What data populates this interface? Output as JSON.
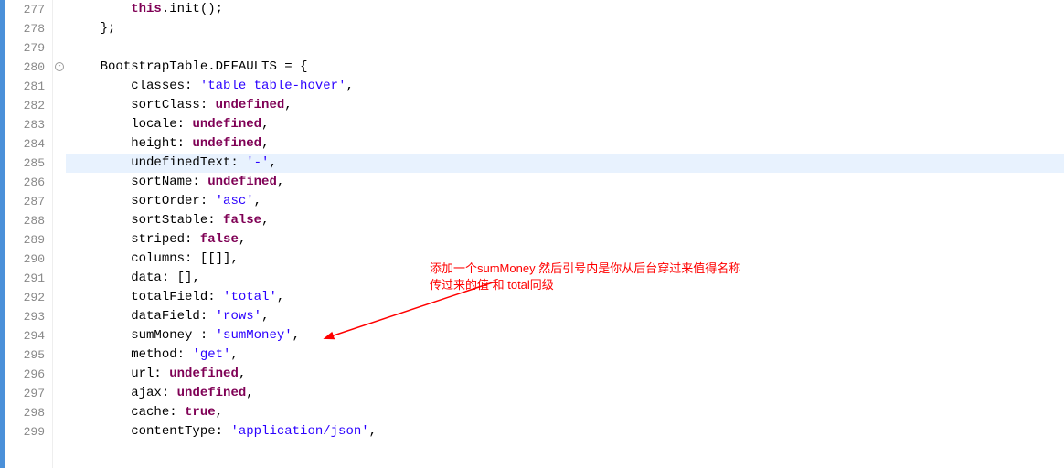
{
  "lineNumbers": [
    "277",
    "278",
    "279",
    "280",
    "281",
    "282",
    "283",
    "284",
    "285",
    "286",
    "287",
    "288",
    "289",
    "290",
    "291",
    "292",
    "293",
    "294",
    "295",
    "296",
    "297",
    "298",
    "299"
  ],
  "code": {
    "l277": {
      "indent": "        ",
      "kw": "this",
      "text": ".init();"
    },
    "l278": {
      "indent": "    ",
      "text": "};"
    },
    "l279": {
      "text": ""
    },
    "l280": {
      "indent": "    ",
      "obj": "BootstrapTable",
      "dot": ".",
      "prop": "DEFAULTS",
      "eq": " = {"
    },
    "l281": {
      "indent": "        ",
      "key": "classes: ",
      "val": "'table table-hover'",
      "end": ","
    },
    "l282": {
      "indent": "        ",
      "key": "sortClass: ",
      "valKw": "undefined",
      "end": ","
    },
    "l283": {
      "indent": "        ",
      "key": "locale: ",
      "valKw": "undefined",
      "end": ","
    },
    "l284": {
      "indent": "        ",
      "key": "height: ",
      "valKw": "undefined",
      "end": ","
    },
    "l285": {
      "indent": "        ",
      "key": "undefinedText: ",
      "val": "'-'",
      "end": ","
    },
    "l286": {
      "indent": "        ",
      "key": "sortName: ",
      "valKw": "undefined",
      "end": ","
    },
    "l287": {
      "indent": "        ",
      "key": "sortOrder: ",
      "val": "'asc'",
      "end": ","
    },
    "l288": {
      "indent": "        ",
      "key": "sortStable: ",
      "valKw": "false",
      "end": ","
    },
    "l289": {
      "indent": "        ",
      "key": "striped: ",
      "valKw": "false",
      "end": ","
    },
    "l290": {
      "indent": "        ",
      "key": "columns: ",
      "valPlain": "[[]]",
      "end": ","
    },
    "l291": {
      "indent": "        ",
      "key": "data: ",
      "valPlain": "[]",
      "end": ","
    },
    "l292": {
      "indent": "        ",
      "key": "totalField: ",
      "val": "'total'",
      "end": ","
    },
    "l293": {
      "indent": "        ",
      "key": "dataField: ",
      "val": "'rows'",
      "end": ","
    },
    "l294": {
      "indent": "        ",
      "key": "sumMoney : ",
      "val": "'sumMoney'",
      "end": ","
    },
    "l295": {
      "indent": "        ",
      "key": "method: ",
      "val": "'get'",
      "end": ","
    },
    "l296": {
      "indent": "        ",
      "key": "url: ",
      "valKw": "undefined",
      "end": ","
    },
    "l297": {
      "indent": "        ",
      "key": "ajax: ",
      "valKw": "undefined",
      "end": ","
    },
    "l298": {
      "indent": "        ",
      "key": "cache: ",
      "valKw": "true",
      "end": ","
    },
    "l299": {
      "indent": "        ",
      "key": "contentType: ",
      "val": "'application/json'",
      "end": ","
    }
  },
  "annotation": {
    "line1": "添加一个sumMoney  然后引号内是你从后台穿过来值得名称",
    "line2": "传过来的值 和 total同级"
  },
  "highlightLine": "285",
  "foldLine": "280"
}
